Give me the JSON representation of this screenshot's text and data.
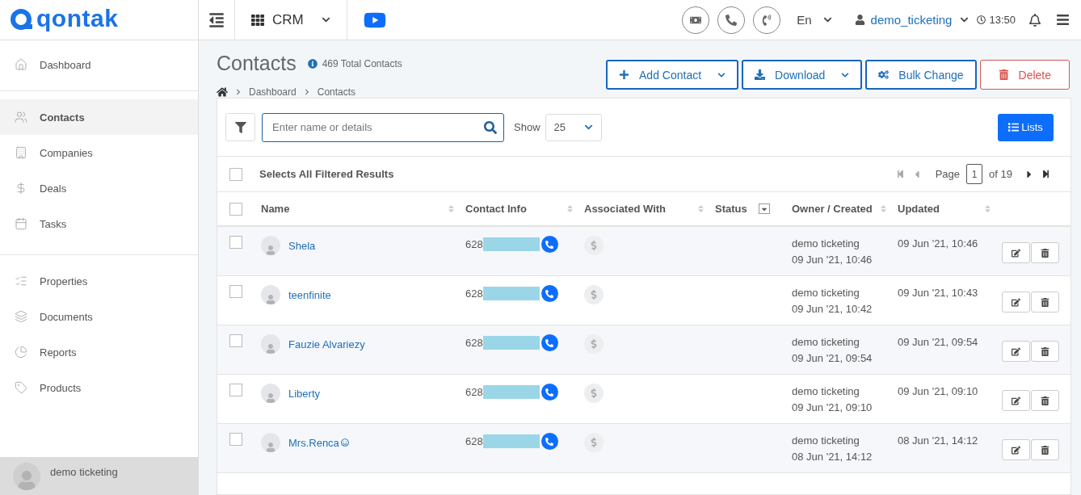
{
  "logo": {
    "text": "qontak"
  },
  "topbar": {
    "app": "CRM",
    "language": "En",
    "user": "demo_ticketing",
    "time": "13:50"
  },
  "sidebar": {
    "groups": [
      {
        "items": [
          {
            "label": "Dashboard",
            "selected": false
          }
        ]
      },
      {
        "items": [
          {
            "label": "Contacts",
            "selected": true
          },
          {
            "label": "Companies",
            "selected": false
          },
          {
            "label": "Deals",
            "selected": false
          },
          {
            "label": "Tasks",
            "selected": false
          }
        ]
      },
      {
        "items": [
          {
            "label": "Properties",
            "selected": false
          },
          {
            "label": "Documents",
            "selected": false
          },
          {
            "label": "Reports",
            "selected": false
          },
          {
            "label": "Products",
            "selected": false
          }
        ]
      }
    ],
    "user": "demo ticketing"
  },
  "page": {
    "title": "Contacts",
    "total": "469 Total Contacts",
    "breadcrumb": [
      "Dashboard",
      "Contacts"
    ]
  },
  "actions": [
    {
      "kind": "add",
      "label": "Add Contact",
      "dropdown": true
    },
    {
      "kind": "download",
      "label": "Download",
      "dropdown": true
    },
    {
      "kind": "bulk",
      "label": "Bulk Change",
      "dropdown": false
    },
    {
      "kind": "delete",
      "label": "Delete",
      "dropdown": false
    }
  ],
  "toolbar": {
    "search_placeholder": "Enter name or details",
    "show_label": "Show",
    "show_value": "25",
    "lists_button": "Lists"
  },
  "select_all": {
    "label": "Selects All Filtered Results",
    "checked": false
  },
  "pagination": {
    "page_label": "Page",
    "page": "1",
    "of": "of 19"
  },
  "table": {
    "all_checked": false,
    "columns": [
      {
        "label": "Name",
        "kind": "sort"
      },
      {
        "label": "Contact Info",
        "kind": "sort"
      },
      {
        "label": "Associated With",
        "kind": "sort"
      },
      {
        "label": "Status",
        "kind": "filter"
      },
      {
        "label": "Owner / Created",
        "kind": "sort"
      },
      {
        "label": "Updated",
        "kind": "sort"
      }
    ],
    "rows": [
      {
        "name": "Shela",
        "emoji": false,
        "phone": "628",
        "owner": "demo ticketing",
        "created": "09 Jun '21, 10:46",
        "updated": "09 Jun '21, 10:46",
        "checked": false
      },
      {
        "name": "teenfinite",
        "emoji": false,
        "phone": "628",
        "owner": "demo ticketing",
        "created": "09 Jun '21, 10:42",
        "updated": "09 Jun '21, 10:43",
        "checked": false
      },
      {
        "name": "Fauzie Alvariezy",
        "emoji": false,
        "phone": "628",
        "owner": "demo ticketing",
        "created": "09 Jun '21, 09:54",
        "updated": "09 Jun '21, 09:54",
        "checked": false
      },
      {
        "name": "Liberty",
        "emoji": false,
        "phone": "628",
        "owner": "demo ticketing",
        "created": "09 Jun '21, 09:10",
        "updated": "09 Jun '21, 09:10",
        "checked": false
      },
      {
        "name": "Mrs.Renca",
        "emoji": true,
        "phone": "628",
        "owner": "demo ticketing",
        "created": "08 Jun '21, 14:12",
        "updated": "08 Jun '21, 14:12",
        "checked": false
      }
    ]
  }
}
